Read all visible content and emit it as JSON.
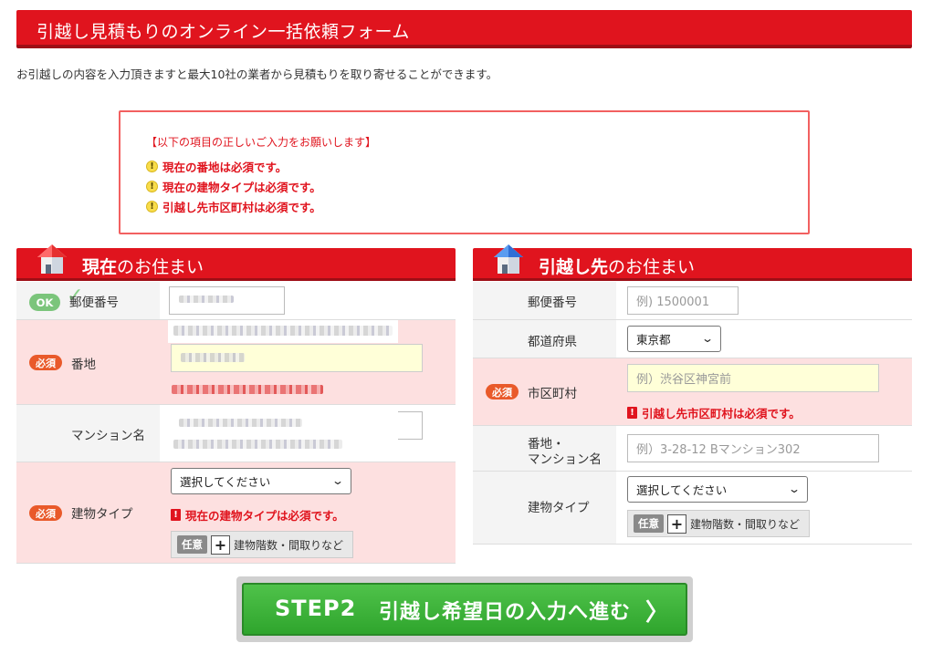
{
  "header": {
    "title": "引越し見積もりのオンライン一括依頼フォーム"
  },
  "intro": "お引越しの内容を入力頂きますと最大10社の業者から見積もりを取り寄せることができます。",
  "error_box": {
    "heading": "【以下の項目の正しいご入力をお願いします】",
    "errors": [
      "現在の番地は必須です。",
      "現在の建物タイプは必須です。",
      "引越し先市区町村は必須です。"
    ],
    "icon": "!"
  },
  "badges": {
    "ok": "OK",
    "required": "必須",
    "optional": "任意",
    "error_mark": "!",
    "plus": "+"
  },
  "current": {
    "title_bold": "現在",
    "title_rest": "のお住まい",
    "postal_label": "郵便番号",
    "address_label": "番地",
    "mansion_label": "マンション名",
    "building_label": "建物タイプ",
    "building_select": "選択してください",
    "building_error": "現在の建物タイプは必須です。",
    "options_text": "建物階数・間取りなど"
  },
  "destination": {
    "title_bold": "引越し先",
    "title_rest": "のお住まい",
    "postal_label": "郵便番号",
    "postal_placeholder": "例) 1500001",
    "pref_label": "都道府県",
    "pref_value": "東京都",
    "city_label": "市区町村",
    "city_placeholder": "例）渋谷区神宮前",
    "city_error": "引越し先市区町村は必須です。",
    "address_label_1": "番地・",
    "address_label_2": "マンション名",
    "address_placeholder": "例）3-28-12 Bマンション302",
    "building_label": "建物タイプ",
    "building_select": "選択してください",
    "options_text": "建物階数・間取りなど"
  },
  "step_button": {
    "step": "STEP2",
    "text": "引越し希望日の入力へ進む",
    "arrow": "〉"
  },
  "colors": {
    "brand_red": "#e0141e",
    "error_bg": "#fde0e0",
    "ok_green": "#7bc57b",
    "button_green": "#2fa52d"
  }
}
